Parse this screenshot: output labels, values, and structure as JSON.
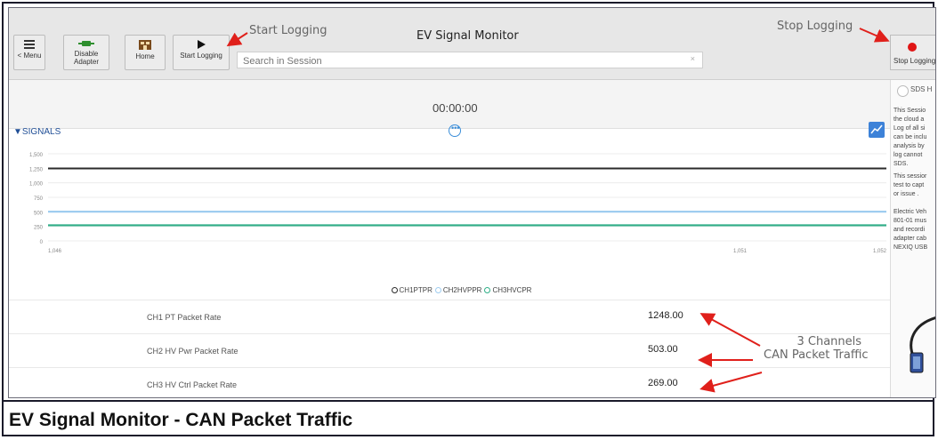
{
  "toolbar": {
    "menu_label": "< Menu",
    "disable_adapter_label": "Disable Adapter",
    "home_label": "Home",
    "start_logging_label": "Start Logging",
    "search_placeholder": "Search in Session",
    "search_clear": "×",
    "app_title": "EV Signal Monitor",
    "stop_logging_label": "Stop Logging"
  },
  "annotations": {
    "start_logging": "Start Logging",
    "stop_logging": "Stop Logging",
    "channels_line1": "3 Channels",
    "channels_line2": "CAN Packet Traffic"
  },
  "timer": "00:00:00",
  "signals_label": "▼SIGNALS",
  "chart_data": {
    "type": "line",
    "x": [
      1.046,
      1.051,
      1.052
    ],
    "x_tick_labels": [
      "1,046",
      "1,051",
      "1,052"
    ],
    "y_tick_labels": [
      "1,500",
      "1,250",
      "1,000",
      "750",
      "500",
      "250",
      "0"
    ],
    "ylim": [
      0,
      1500
    ],
    "series": [
      {
        "name": "CH1PTPR",
        "values": [
          1248,
          1248,
          1248
        ],
        "color": "#2b2b2b"
      },
      {
        "name": "CH2HVPPR",
        "values": [
          503,
          503,
          503
        ],
        "color": "#9fcdf0"
      },
      {
        "name": "CH3HVCPR",
        "values": [
          269,
          269,
          269
        ],
        "color": "#2fae87"
      }
    ],
    "grid": true,
    "legend": "bottom"
  },
  "channels": [
    {
      "name": "CH1 PT Packet Rate",
      "value": "1248.00"
    },
    {
      "name": "CH2 HV Pwr Packet Rate",
      "value": "503.00"
    },
    {
      "name": "CH3 HV Ctrl Packet Rate",
      "value": "269.00"
    }
  ],
  "right_panel": {
    "radio_label": "SDS H",
    "p1": "This Sessio\nthe cloud a\nLog of all si\ncan be inclu\nanalysis by\nlog cannot\nSDS.",
    "p2": "This sessior\ntest to capt\nor issue .",
    "p3": "Electric Veh\n801-01 mus\nand recordi\nadapter cab\nNEXIQ USB"
  },
  "caption": "EV Signal Monitor - CAN Packet Traffic",
  "colors": {
    "arrow": "#e0201b",
    "accent": "#3d82d8",
    "stop": "#e01515"
  }
}
